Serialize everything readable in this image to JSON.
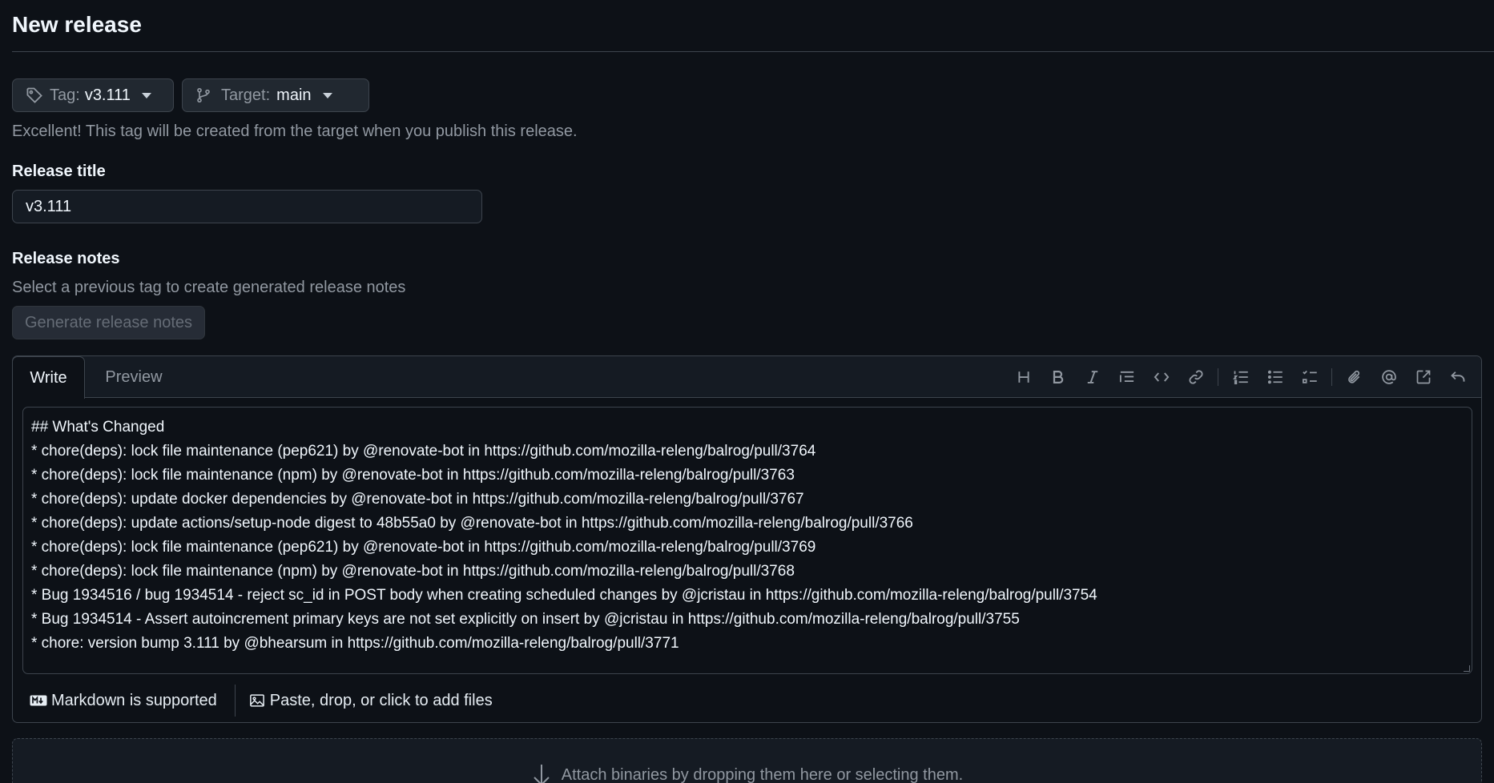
{
  "page": {
    "title": "New release"
  },
  "tag_picker": {
    "label": "Tag:",
    "value": "v3.111"
  },
  "target_picker": {
    "label": "Target:",
    "value": "main"
  },
  "tag_hint": "Excellent! This tag will be created from the target when you publish this release.",
  "release_title": {
    "label": "Release title",
    "value": "v3.111"
  },
  "release_notes": {
    "label": "Release notes",
    "hint": "Select a previous tag to create generated release notes",
    "generate_label": "Generate release notes"
  },
  "editor": {
    "tabs": {
      "write": "Write",
      "preview": "Preview"
    },
    "lines": [
      "## What's Changed",
      "* chore(deps): lock file maintenance (pep621) by @renovate-bot in https://github.com/mozilla-releng/balrog/pull/3764",
      "* chore(deps): lock file maintenance (npm) by @renovate-bot in https://github.com/mozilla-releng/balrog/pull/3763",
      "* chore(deps): update docker dependencies by @renovate-bot in https://github.com/mozilla-releng/balrog/pull/3767",
      "* chore(deps): update actions/setup-node digest to 48b55a0 by @renovate-bot in https://github.com/mozilla-releng/balrog/pull/3766",
      "* chore(deps): lock file maintenance (pep621) by @renovate-bot in https://github.com/mozilla-releng/balrog/pull/3769",
      "* chore(deps): lock file maintenance (npm) by @renovate-bot in https://github.com/mozilla-releng/balrog/pull/3768",
      "* Bug 1934516 / bug 1934514 - reject sc_id in POST body when creating scheduled changes by @jcristau in https://github.com/mozilla-releng/balrog/pull/3754",
      "* Bug 1934514 - Assert autoincrement primary keys are not set explicitly on insert by @jcristau in https://github.com/mozilla-releng/balrog/pull/3755",
      "* chore: version bump 3.111 by @bhearsum in https://github.com/mozilla-releng/balrog/pull/3771"
    ],
    "toolbar_icons": [
      "heading-icon",
      "bold-icon",
      "italic-icon",
      "quote-icon",
      "code-icon",
      "link-icon",
      "ordered-list-icon",
      "unordered-list-icon",
      "task-list-icon",
      "attach-icon",
      "mention-icon",
      "reference-icon",
      "undo-icon"
    ],
    "markdown_note": "Markdown is supported",
    "files_note": "Paste, drop, or click to add files"
  },
  "dropzone": {
    "text": "Attach binaries by dropping them here or selecting them."
  },
  "colors": {
    "background": "#0d1117",
    "border": "#3d444d",
    "muted": "#9198a1",
    "text": "#f0f6fc"
  }
}
